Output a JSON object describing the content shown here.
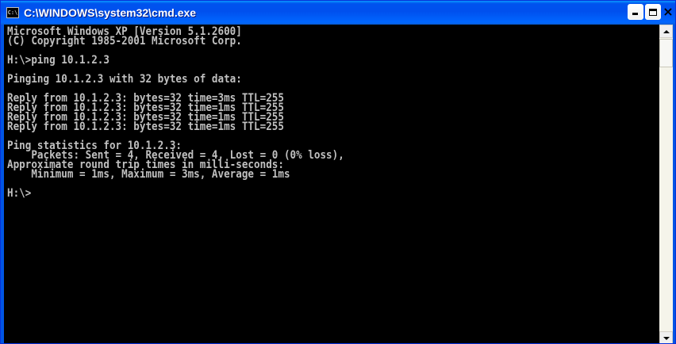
{
  "window": {
    "title": "C:\\WINDOWS\\system32\\cmd.exe",
    "icon": "console-icon",
    "buttons": {
      "minimize_icon": "minimize-icon",
      "maximize_icon": "maximize-icon",
      "close_glyph": "×"
    }
  },
  "console": {
    "lines": [
      "Microsoft Windows XP [Version 5.1.2600]",
      "(C) Copyright 1985-2001 Microsoft Corp.",
      "",
      "H:\\>ping 10.1.2.3",
      "",
      "Pinging 10.1.2.3 with 32 bytes of data:",
      "",
      "Reply from 10.1.2.3: bytes=32 time=3ms TTL=255",
      "Reply from 10.1.2.3: bytes=32 time=1ms TTL=255",
      "Reply from 10.1.2.3: bytes=32 time=1ms TTL=255",
      "Reply from 10.1.2.3: bytes=32 time=1ms TTL=255",
      "",
      "Ping statistics for 10.1.2.3:",
      "    Packets: Sent = 4, Received = 4, Lost = 0 (0% loss),",
      "Approximate round trip times in milli-seconds:",
      "    Minimum = 1ms, Maximum = 3ms, Average = 1ms",
      "",
      "H:\\>"
    ]
  },
  "colors": {
    "titlebar": "#0055e5",
    "console_bg": "#000000",
    "console_fg": "#c0c0c0"
  }
}
